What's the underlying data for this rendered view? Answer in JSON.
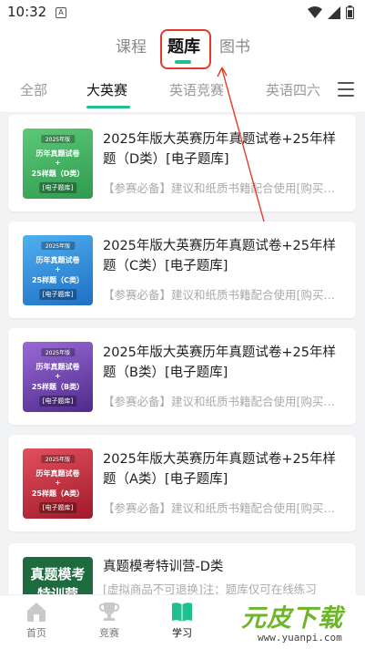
{
  "status_bar": {
    "time": "10:32",
    "notification_icon": "A"
  },
  "top_tabs": {
    "items": [
      {
        "label": "课程"
      },
      {
        "label": "题库"
      },
      {
        "label": "图书"
      }
    ],
    "active": 1
  },
  "sub_tabs": {
    "items": [
      {
        "label": "全部"
      },
      {
        "label": "大英赛"
      },
      {
        "label": "英语竞赛"
      },
      {
        "label": "英语四六"
      }
    ],
    "active": 1
  },
  "colors": {
    "accent": "#1fbf8f",
    "annotation": "#e23a2a"
  },
  "products": [
    {
      "title": "2025年版大英赛历年真题试卷+25年样题（D类）[电子题库]",
      "subtitle": "【参赛必备】建议和纸质书籍配合使用[购买…",
      "cover": {
        "year": "2025年版",
        "line1": "历年真题试卷",
        "plus": "+",
        "line2": "25样题（D类）",
        "badge": "[电子题库]",
        "color": "#3aa55a"
      }
    },
    {
      "title": "2025年版大英赛历年真题试卷+25年样题（C类）[电子题库]",
      "subtitle": "【参赛必备】建议和纸质书籍配合使用[购买…",
      "cover": {
        "year": "2025年版",
        "line1": "历年真题试卷",
        "plus": "+",
        "line2": "25样题（C类）",
        "badge": "[电子题库]",
        "color": "#2a86d6"
      }
    },
    {
      "title": "2025年版大英赛历年真题试卷+25年样题（B类）[电子题库]",
      "subtitle": "【参赛必备】建议和纸质书籍配合使用[购买…",
      "cover": {
        "year": "2025年版",
        "line1": "历年真题试卷",
        "plus": "+",
        "line2": "25样题（B类）",
        "badge": "[电子题库]",
        "color": "#6b3fb0"
      }
    },
    {
      "title": "2025年版大英赛历年真题试卷+25年样题（A类）[电子题库]",
      "subtitle": "【参赛必备】建议和纸质书籍配合使用[购买…",
      "cover": {
        "year": "2025年版",
        "line1": "历年真题试卷",
        "plus": "+",
        "line2": "25样题（A类）",
        "badge": "[电子题库]",
        "color": "#c8283a"
      }
    }
  ],
  "product5": {
    "title": "真题模考特训营-D类",
    "subtitle": "[虚拟商品不可退换]注：题库仅可在线练习",
    "cover_line1": "真题模考",
    "cover_line2": "特训营"
  },
  "bottom_nav": {
    "items": [
      {
        "label": "首页",
        "icon": "home-icon"
      },
      {
        "label": "竞赛",
        "icon": "trophy-icon"
      },
      {
        "label": "学习",
        "icon": "book-icon"
      }
    ],
    "active": 2
  },
  "watermark": {
    "main": "元皮下载",
    "sub": "www.yuanpi.com"
  }
}
